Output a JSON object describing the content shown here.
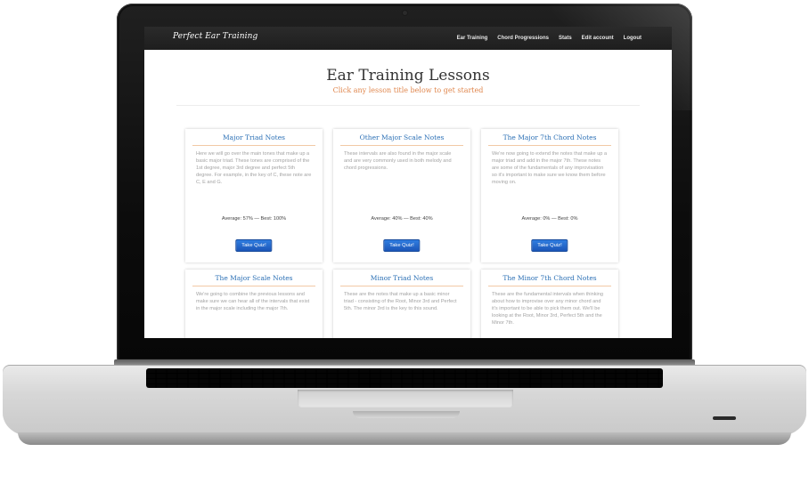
{
  "site": {
    "brand": "Perfect Ear Training",
    "nav": [
      {
        "label": "Ear Training"
      },
      {
        "label": "Chord Progressions"
      },
      {
        "label": "Stats"
      },
      {
        "label": "Edit account"
      },
      {
        "label": "Logout"
      }
    ]
  },
  "hero": {
    "title": "Ear Training Lessons",
    "subtitle": "Click any lesson title below to get started"
  },
  "lessons": [
    {
      "title": "Major Triad Notes",
      "description": "Here we will go over the main tones that make up a basic major triad. These tones are comprised of the 1st degree, major 3rd degree and perfect 5th degree. For example, in the key of C, these note are C, E and G.",
      "stats": "Average: 57% — Best: 100%",
      "button": "Take Quiz!"
    },
    {
      "title": "Other Major Scale Notes",
      "description": "These intervals are also found in the major scale and are very commonly used in both melody and chord progressions.",
      "stats": "Average: 40% — Best: 40%",
      "button": "Take Quiz!"
    },
    {
      "title": "The Major 7th Chord Notes",
      "description": "We're now going to extend the notes that make up a major triad and add in the major 7th. These notes are some of the fundamentals of any improvisation so it's important to make sure we know them before moving on.",
      "stats": "Average: 0% — Best: 0%",
      "button": "Take Quiz!"
    },
    {
      "title": "The Major Scale Notes",
      "description": "We're going to combine the previous lessons and make sure we can hear all of the intervals that exist in the major scale including the major 7th.",
      "stats": "",
      "button": ""
    },
    {
      "title": "Minor Triad Notes",
      "description": "These are the notes that make up a basic minor triad - consisting of the Root, Minor 3rd and Perfect 5th. The minor 3rd is the key to this sound.",
      "stats": "",
      "button": ""
    },
    {
      "title": "The Minor 7th Chord Notes",
      "description": "These are the fundamental intervals when thinking about how to improvise over any minor chord and it's important to be able to pick them out. We'll be looking at the Root, Minor 3rd, Perfect 5th and the Minor 7th.",
      "stats": "",
      "button": ""
    }
  ],
  "colors": {
    "navbar": "#1e1e1e",
    "accent_title": "#2a6fb5",
    "subtitle": "#e0874e",
    "button": "#1c56b8"
  }
}
